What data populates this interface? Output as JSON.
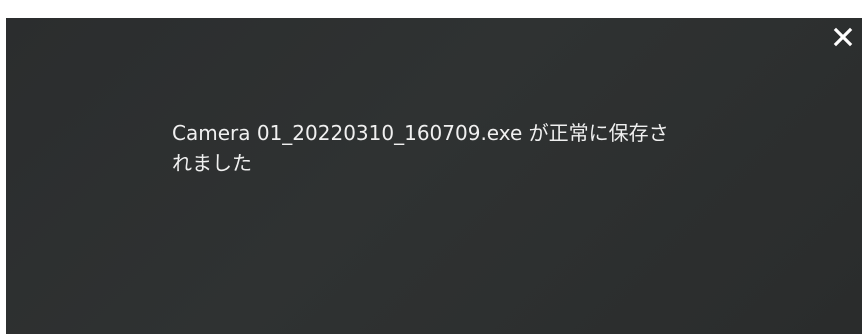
{
  "notification": {
    "message_line1": "Camera 01_20220310_160709.exe が正常に保存さ",
    "message_line2": "れました",
    "close_icon": "close-icon"
  },
  "colors": {
    "background": "#2d2f30",
    "text": "#f0f0f0",
    "close_icon": "#ffffff"
  }
}
